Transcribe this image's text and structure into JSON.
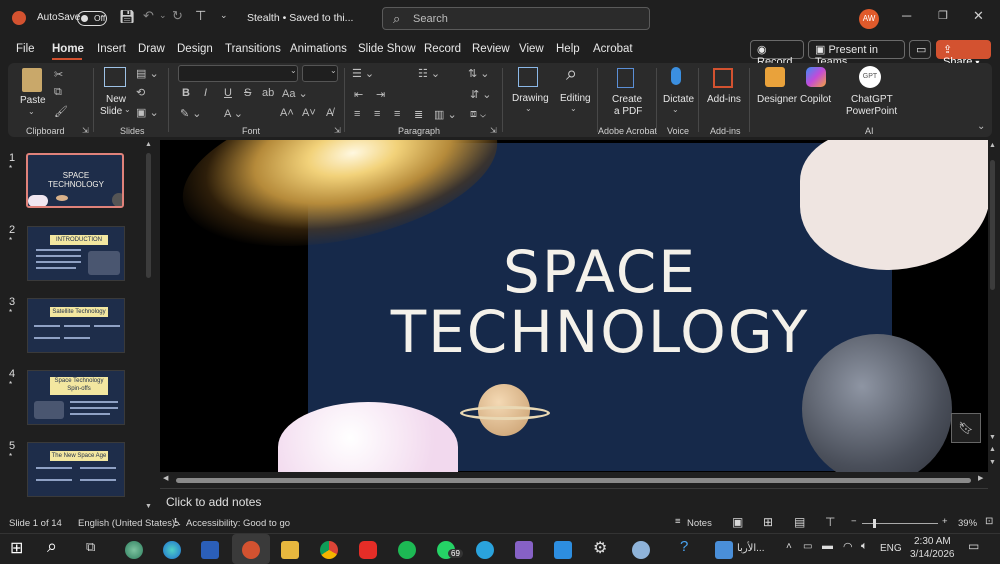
{
  "titlebar": {
    "autosave_label": "AutoSave",
    "autosave_state": "Off",
    "doc_title": "Stealth • Saved to thi...",
    "search_placeholder": "Search",
    "avatar_initials": "AW"
  },
  "menu": {
    "items": [
      "File",
      "Home",
      "Insert",
      "Draw",
      "Design",
      "Transitions",
      "Animations",
      "Slide Show",
      "Record",
      "Review",
      "View",
      "Help",
      "Acrobat"
    ],
    "active": "Home",
    "record_button": "Record",
    "present_teams_button": "Present in Teams",
    "share_button": "Share"
  },
  "ribbon": {
    "paste_label": "Paste",
    "clipboard_label": "Clipboard",
    "new_slide_label_1": "New",
    "new_slide_label_2": "Slide",
    "slides_label": "Slides",
    "font_label": "Font",
    "paragraph_label": "Paragraph",
    "drawing_label": "Drawing",
    "editing_label": "Editing",
    "create_pdf_label_1": "Create",
    "create_pdf_label_2": "a PDF",
    "adobe_label": "Adobe Acrobat",
    "dictate_label": "Dictate",
    "voice_label": "Voice",
    "addins_button": "Add-ins",
    "addins_group": "Add-ins",
    "designer_label": "Designer",
    "copilot_label": "Copilot",
    "chatgpt_label_1": "ChatGPT",
    "chatgpt_label_2": "PowerPoint",
    "chatgpt_icon_text": "GPT",
    "ai_label": "AI"
  },
  "thumbnails": [
    {
      "num": "1",
      "title": "SPACE TECHNOLOGY"
    },
    {
      "num": "2",
      "title": "INTRODUCTION"
    },
    {
      "num": "3",
      "title": "Satellite Technology"
    },
    {
      "num": "4",
      "title": "Space Technology Spin-offs"
    },
    {
      "num": "5",
      "title": "The New Space Age"
    }
  ],
  "slide": {
    "title_line1": "SPACE",
    "title_line2": "TECHNOLOGY"
  },
  "notes_placeholder": "Click to add notes",
  "status": {
    "slide_count": "Slide 1 of 14",
    "language": "English (United States)",
    "accessibility": "Accessibility: Good to go",
    "notes": "Notes",
    "zoom": "39%"
  },
  "taskbar": {
    "whatsapp_badge": "69",
    "search_widget": "الأربا...",
    "lang": "ENG",
    "time": "2:30 AM",
    "date": "3/14/2026"
  },
  "colors": {
    "accent": "#d35230",
    "slide_bg": "#16294a"
  }
}
